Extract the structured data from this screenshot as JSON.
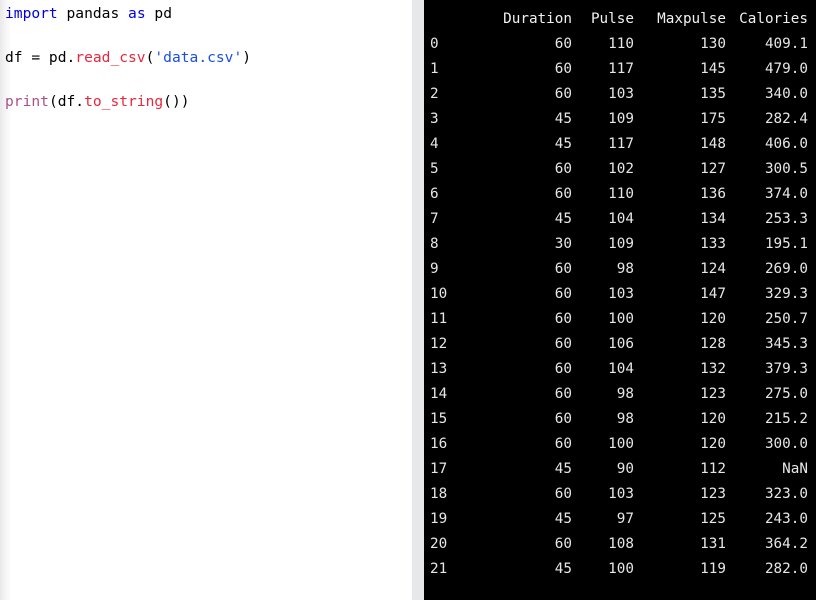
{
  "editor": {
    "language": "python",
    "lines": [
      {
        "id": "line-import",
        "tokens": [
          {
            "text": "import",
            "type": "keyword"
          },
          {
            "text": " ",
            "type": "plain"
          },
          {
            "text": "pandas",
            "type": "plain"
          },
          {
            "text": " ",
            "type": "plain"
          },
          {
            "text": "as",
            "type": "keyword"
          },
          {
            "text": " ",
            "type": "plain"
          },
          {
            "text": "pd",
            "type": "plain"
          }
        ]
      },
      {
        "id": "line-read-csv",
        "tokens": [
          {
            "text": "df = pd.",
            "type": "plain"
          },
          {
            "text": "read_csv",
            "type": "function"
          },
          {
            "text": "(",
            "type": "plain"
          },
          {
            "text": "'data.csv'",
            "type": "string"
          },
          {
            "text": ")",
            "type": "plain"
          }
        ]
      },
      {
        "id": "line-print",
        "tokens": [
          {
            "text": "print",
            "type": "builtin"
          },
          {
            "text": "(df.",
            "type": "plain"
          },
          {
            "text": "to_string",
            "type": "function"
          },
          {
            "text": "())",
            "type": "plain"
          }
        ]
      }
    ]
  },
  "terminal": {
    "background": "#000000",
    "foreground": "#e6e6e6",
    "columns": [
      "",
      "Duration",
      "Pulse",
      "Maxpulse",
      "Calories"
    ],
    "rows": [
      {
        "index": "0",
        "Duration": "60",
        "Pulse": "110",
        "Maxpulse": "130",
        "Calories": "409.1"
      },
      {
        "index": "1",
        "Duration": "60",
        "Pulse": "117",
        "Maxpulse": "145",
        "Calories": "479.0"
      },
      {
        "index": "2",
        "Duration": "60",
        "Pulse": "103",
        "Maxpulse": "135",
        "Calories": "340.0"
      },
      {
        "index": "3",
        "Duration": "45",
        "Pulse": "109",
        "Maxpulse": "175",
        "Calories": "282.4"
      },
      {
        "index": "4",
        "Duration": "45",
        "Pulse": "117",
        "Maxpulse": "148",
        "Calories": "406.0"
      },
      {
        "index": "5",
        "Duration": "60",
        "Pulse": "102",
        "Maxpulse": "127",
        "Calories": "300.5"
      },
      {
        "index": "6",
        "Duration": "60",
        "Pulse": "110",
        "Maxpulse": "136",
        "Calories": "374.0"
      },
      {
        "index": "7",
        "Duration": "45",
        "Pulse": "104",
        "Maxpulse": "134",
        "Calories": "253.3"
      },
      {
        "index": "8",
        "Duration": "30",
        "Pulse": "109",
        "Maxpulse": "133",
        "Calories": "195.1"
      },
      {
        "index": "9",
        "Duration": "60",
        "Pulse": "98",
        "Maxpulse": "124",
        "Calories": "269.0"
      },
      {
        "index": "10",
        "Duration": "60",
        "Pulse": "103",
        "Maxpulse": "147",
        "Calories": "329.3"
      },
      {
        "index": "11",
        "Duration": "60",
        "Pulse": "100",
        "Maxpulse": "120",
        "Calories": "250.7"
      },
      {
        "index": "12",
        "Duration": "60",
        "Pulse": "106",
        "Maxpulse": "128",
        "Calories": "345.3"
      },
      {
        "index": "13",
        "Duration": "60",
        "Pulse": "104",
        "Maxpulse": "132",
        "Calories": "379.3"
      },
      {
        "index": "14",
        "Duration": "60",
        "Pulse": "98",
        "Maxpulse": "123",
        "Calories": "275.0"
      },
      {
        "index": "15",
        "Duration": "60",
        "Pulse": "98",
        "Maxpulse": "120",
        "Calories": "215.2"
      },
      {
        "index": "16",
        "Duration": "60",
        "Pulse": "100",
        "Maxpulse": "120",
        "Calories": "300.0"
      },
      {
        "index": "17",
        "Duration": "45",
        "Pulse": "90",
        "Maxpulse": "112",
        "Calories": "NaN"
      },
      {
        "index": "18",
        "Duration": "60",
        "Pulse": "103",
        "Maxpulse": "123",
        "Calories": "323.0"
      },
      {
        "index": "19",
        "Duration": "45",
        "Pulse": "97",
        "Maxpulse": "125",
        "Calories": "243.0"
      },
      {
        "index": "20",
        "Duration": "60",
        "Pulse": "108",
        "Maxpulse": "131",
        "Calories": "364.2"
      },
      {
        "index": "21",
        "Duration": "45",
        "Pulse": "100",
        "Maxpulse": "119",
        "Calories": "282.0"
      }
    ]
  }
}
